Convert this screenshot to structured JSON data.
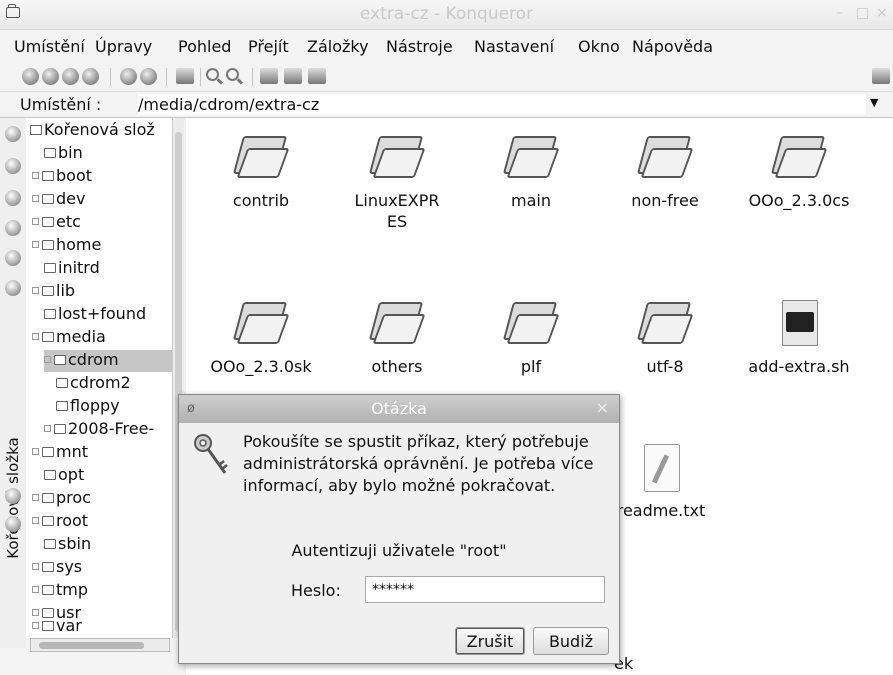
{
  "window": {
    "title": "extra-cz - Konqueror"
  },
  "menu": [
    "Umístění",
    "Úpravy",
    "Pohled",
    "Přejít",
    "Záložky",
    "Nástroje",
    "Nastavení",
    "Okno",
    "Nápověda"
  ],
  "location": {
    "label": "Umístění :",
    "path": "/media/cdrom/extra-cz"
  },
  "sidebar": {
    "vertical_label": "Kořenová složka"
  },
  "tree": [
    "Kořenová slož",
    "bin",
    "boot",
    "dev",
    "etc",
    "home",
    "initrd",
    "lib",
    "lost+found",
    "media",
    "cdrom",
    "cdrom2",
    "floppy",
    "2008-Free-",
    "mnt",
    "opt",
    "proc",
    "root",
    "sbin",
    "sys",
    "tmp",
    "usr",
    "var"
  ],
  "files": [
    "contrib",
    "LinuxEXPR ES",
    "main",
    "non-free",
    "OOo_2.3.0cs",
    "OOo_2.3.0sk",
    "others",
    "plf",
    "utf-8",
    "add-extra.sh",
    "readme.txt"
  ],
  "status_fragment": "ek",
  "dialog": {
    "title": "Otázka",
    "message": "Pokoušíte se spustit příkaz, který potřebuje administrátorská oprávnění. Je potřeba více informací, aby bylo možné pokračovat.",
    "auth_text": "Autentizuji uživatele \"root\"",
    "password_label": "Heslo:",
    "password_value": "******",
    "cancel_label": "Zrušit",
    "ok_label": "Budiž"
  }
}
